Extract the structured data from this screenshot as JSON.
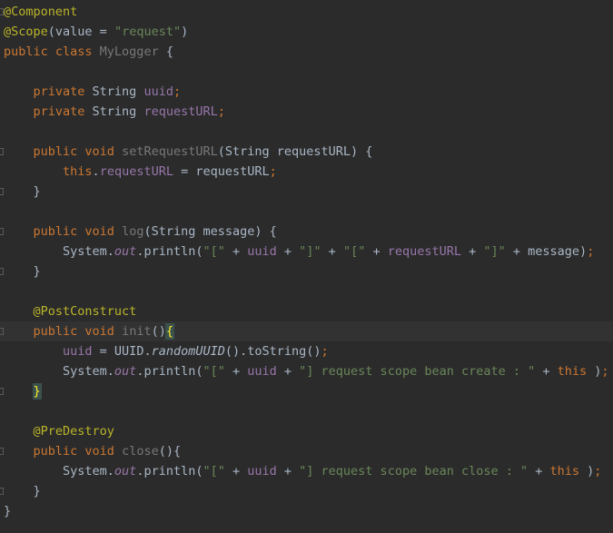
{
  "editor": {
    "lines": [
      [
        {
          "c": "ann",
          "t": "@Component"
        }
      ],
      [
        {
          "c": "ann",
          "t": "@Scope"
        },
        {
          "c": "plain",
          "t": "(value = "
        },
        {
          "c": "str",
          "t": "\"request\""
        },
        {
          "c": "plain",
          "t": ")"
        }
      ],
      [
        {
          "c": "kw",
          "t": "public class "
        },
        {
          "c": "dim",
          "t": "MyLogger"
        },
        {
          "c": "plain",
          "t": " {"
        }
      ],
      [],
      [
        {
          "c": "plain",
          "t": "    "
        },
        {
          "c": "kw",
          "t": "private "
        },
        {
          "c": "plain",
          "t": "String "
        },
        {
          "c": "fld",
          "t": "uuid"
        },
        {
          "c": "kw",
          "t": ";"
        }
      ],
      [
        {
          "c": "plain",
          "t": "    "
        },
        {
          "c": "kw",
          "t": "private "
        },
        {
          "c": "plain",
          "t": "String "
        },
        {
          "c": "fld",
          "t": "requestURL"
        },
        {
          "c": "kw",
          "t": ";"
        }
      ],
      [],
      [
        {
          "c": "plain",
          "t": "    "
        },
        {
          "c": "kw",
          "t": "public void "
        },
        {
          "c": "dim",
          "t": "setRequestURL"
        },
        {
          "c": "plain",
          "t": "(String requestURL) {"
        }
      ],
      [
        {
          "c": "plain",
          "t": "        "
        },
        {
          "c": "kw",
          "t": "this"
        },
        {
          "c": "plain",
          "t": "."
        },
        {
          "c": "fld",
          "t": "requestURL"
        },
        {
          "c": "plain",
          "t": " = requestURL"
        },
        {
          "c": "kw",
          "t": ";"
        }
      ],
      [
        {
          "c": "plain",
          "t": "    }"
        }
      ],
      [],
      [
        {
          "c": "plain",
          "t": "    "
        },
        {
          "c": "kw",
          "t": "public void "
        },
        {
          "c": "dim",
          "t": "log"
        },
        {
          "c": "plain",
          "t": "(String message) {"
        }
      ],
      [
        {
          "c": "plain",
          "t": "        System."
        },
        {
          "c": "stat",
          "t": "out"
        },
        {
          "c": "plain",
          "t": ".println("
        },
        {
          "c": "str",
          "t": "\"[\""
        },
        {
          "c": "plain",
          "t": " + "
        },
        {
          "c": "fld",
          "t": "uuid"
        },
        {
          "c": "plain",
          "t": " + "
        },
        {
          "c": "str",
          "t": "\"]\""
        },
        {
          "c": "plain",
          "t": " + "
        },
        {
          "c": "str",
          "t": "\"[\""
        },
        {
          "c": "plain",
          "t": " + "
        },
        {
          "c": "fld",
          "t": "requestURL"
        },
        {
          "c": "plain",
          "t": " + "
        },
        {
          "c": "str",
          "t": "\"]\""
        },
        {
          "c": "plain",
          "t": " + message)"
        },
        {
          "c": "kw",
          "t": ";"
        }
      ],
      [
        {
          "c": "plain",
          "t": "    }"
        }
      ],
      [],
      [
        {
          "c": "plain",
          "t": "    "
        },
        {
          "c": "ann",
          "t": "@PostConstruct"
        }
      ],
      [
        {
          "c": "plain",
          "t": "    "
        },
        {
          "c": "kw",
          "t": "public void "
        },
        {
          "c": "dim",
          "t": "init"
        },
        {
          "c": "plain",
          "t": "()"
        },
        {
          "c": "match",
          "t": "{"
        }
      ],
      [
        {
          "c": "plain",
          "t": "        "
        },
        {
          "c": "fld",
          "t": "uuid"
        },
        {
          "c": "plain",
          "t": " = UUID."
        },
        {
          "c": "ital",
          "t": "randomUUID"
        },
        {
          "c": "plain",
          "t": "().toString()"
        },
        {
          "c": "kw",
          "t": ";"
        }
      ],
      [
        {
          "c": "plain",
          "t": "        System."
        },
        {
          "c": "stat",
          "t": "out"
        },
        {
          "c": "plain",
          "t": ".println("
        },
        {
          "c": "str",
          "t": "\"[\""
        },
        {
          "c": "plain",
          "t": " + "
        },
        {
          "c": "fld",
          "t": "uuid"
        },
        {
          "c": "plain",
          "t": " + "
        },
        {
          "c": "str",
          "t": "\"] request scope bean create : \""
        },
        {
          "c": "plain",
          "t": " + "
        },
        {
          "c": "kw",
          "t": "this"
        },
        {
          "c": "plain",
          "t": " )"
        },
        {
          "c": "kw",
          "t": ";"
        }
      ],
      [
        {
          "c": "plain",
          "t": "    "
        },
        {
          "c": "match",
          "t": "}"
        }
      ],
      [],
      [
        {
          "c": "plain",
          "t": "    "
        },
        {
          "c": "ann",
          "t": "@PreDestroy"
        }
      ],
      [
        {
          "c": "plain",
          "t": "    "
        },
        {
          "c": "kw",
          "t": "public void "
        },
        {
          "c": "dim",
          "t": "close"
        },
        {
          "c": "plain",
          "t": "(){"
        }
      ],
      [
        {
          "c": "plain",
          "t": "        System."
        },
        {
          "c": "stat",
          "t": "out"
        },
        {
          "c": "plain",
          "t": ".println("
        },
        {
          "c": "str",
          "t": "\"[\""
        },
        {
          "c": "plain",
          "t": " + "
        },
        {
          "c": "fld",
          "t": "uuid"
        },
        {
          "c": "plain",
          "t": " + "
        },
        {
          "c": "str",
          "t": "\"] request scope bean close : \""
        },
        {
          "c": "plain",
          "t": " + "
        },
        {
          "c": "kw",
          "t": "this"
        },
        {
          "c": "plain",
          "t": " )"
        },
        {
          "c": "kw",
          "t": ";"
        }
      ],
      [
        {
          "c": "plain",
          "t": "    }"
        }
      ],
      [
        {
          "c": "plain",
          "t": "}"
        }
      ]
    ],
    "current_line": 16,
    "fold_markers": [
      0,
      7,
      9,
      11,
      13,
      16,
      19,
      22,
      24
    ]
  },
  "colors": {
    "background": "#2b2b2b",
    "current_line": "#323232",
    "keyword": "#cc7832",
    "annotation": "#bbb529",
    "string": "#6a8759",
    "field": "#9876aa",
    "text": "#a9b7c6"
  }
}
